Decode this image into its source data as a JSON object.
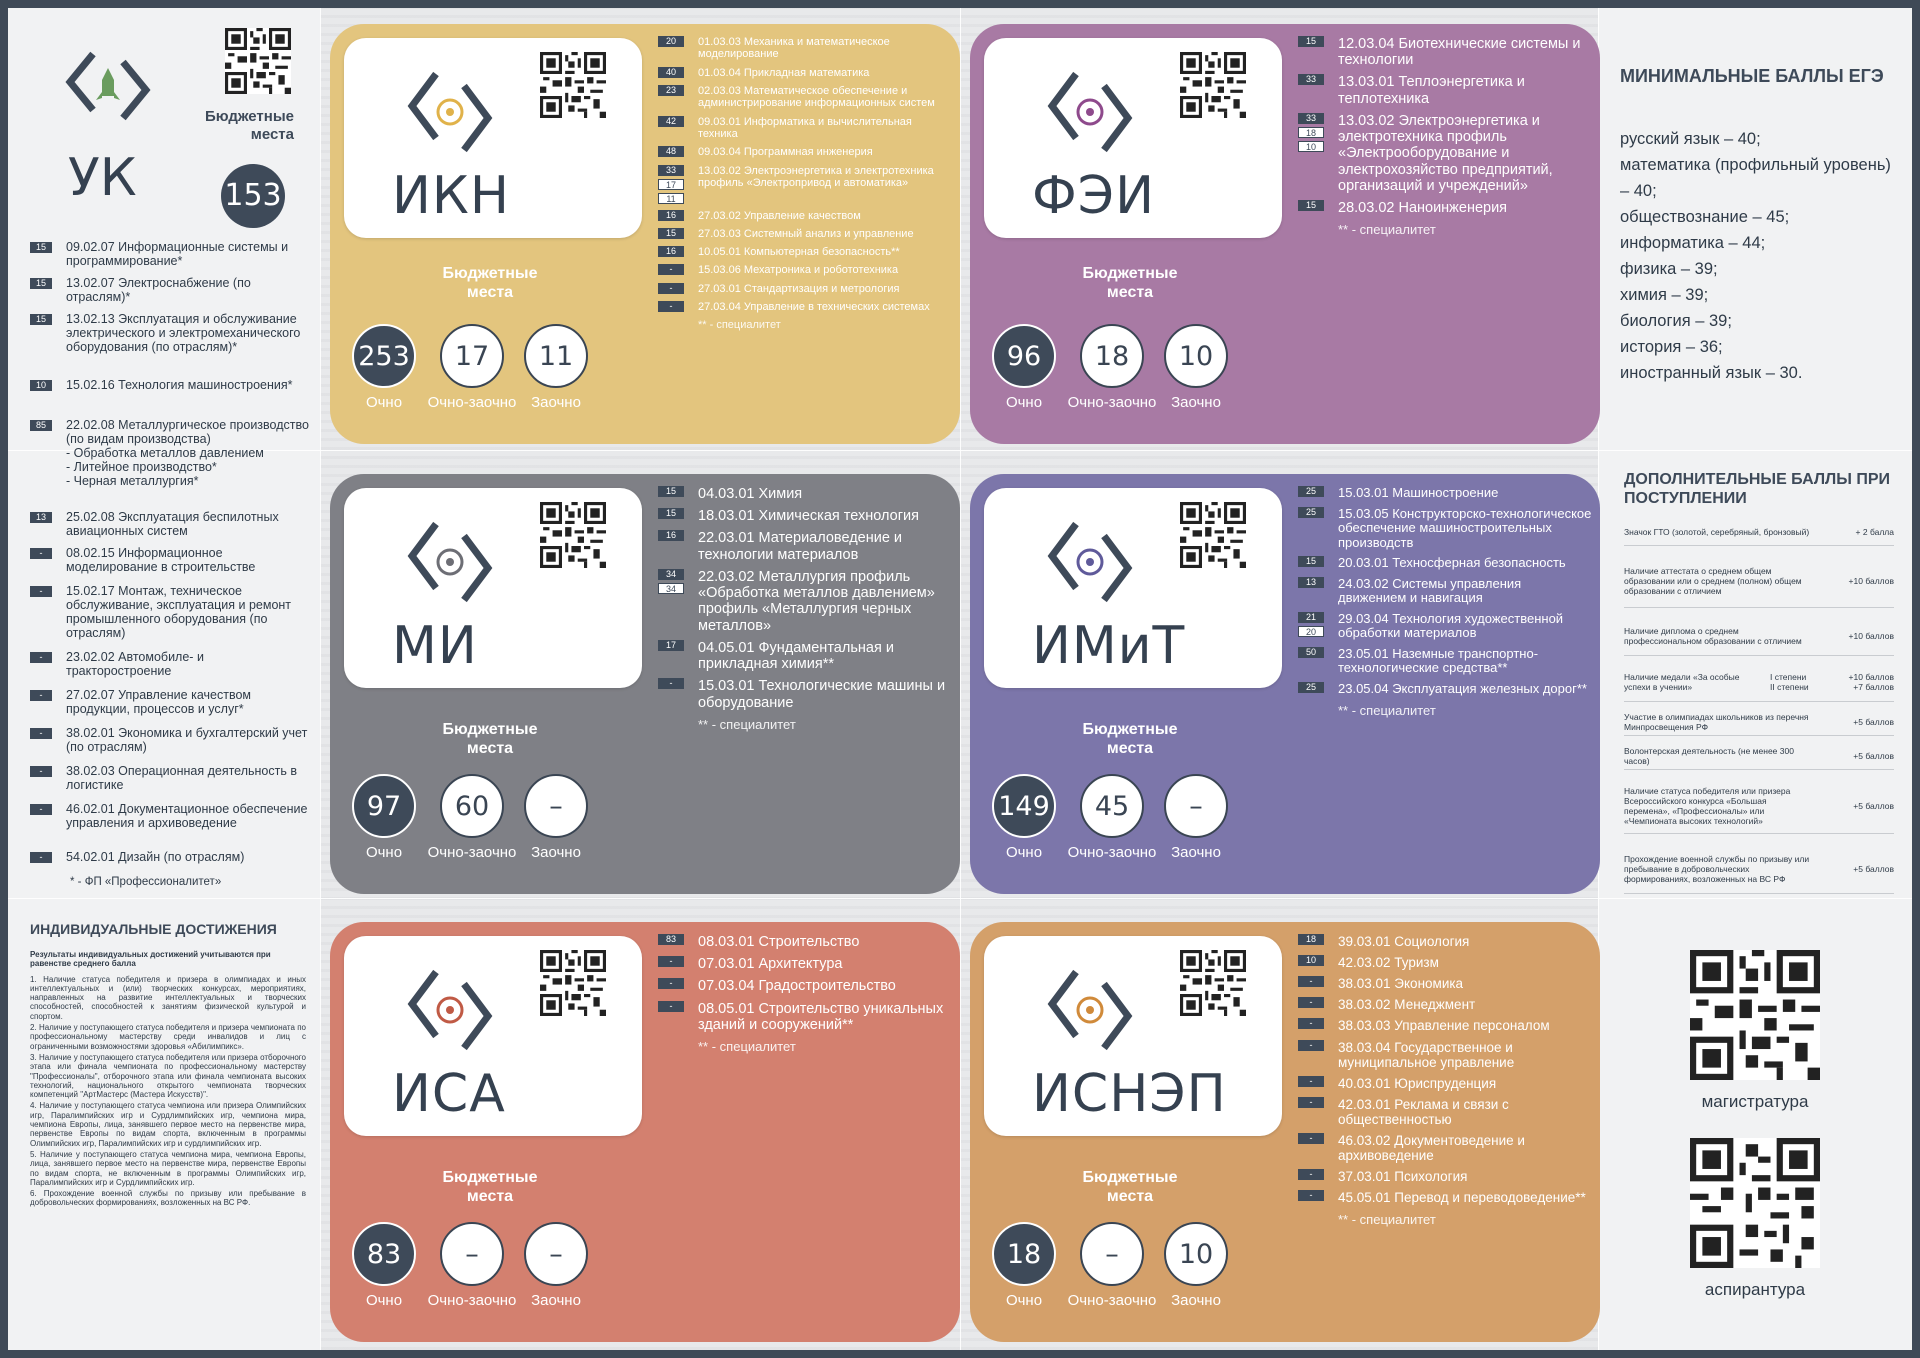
{
  "uk": {
    "abbr": "УК",
    "budget_label": "Бюджетные места",
    "budget": "153",
    "footnote": "* - ФП «Профессионалитет»",
    "programs": [
      {
        "n": "15",
        "t": "09.02.07  Информационные системы и программирование*"
      },
      {
        "n": "15",
        "t": "13.02.07  Электроснабжение (по отраслям)*"
      },
      {
        "n": "15",
        "t": "13.02.13  Эксплуатация и обслуживание электрического и электромеханического оборудования (по отраслям)*"
      },
      {
        "n": "10",
        "t": "15.02.16  Технология машиностроения*"
      },
      {
        "n": "85",
        "t": "22.02.08  Металлургическое производство (по видам производства)\n- Обработка металлов давлением\n- Литейное производство*\n- Черная металлургия*"
      },
      {
        "n": "13",
        "t": "25.02.08  Эксплуатация беспилотных авиационных систем"
      },
      {
        "n": "-",
        "t": "08.02.15  Информационное моделирование в строительстве"
      },
      {
        "n": "-",
        "t": "15.02.17  Монтаж, техническое обслуживание, эксплуатация и ремонт промышленного оборудования (по отраслям)"
      },
      {
        "n": "-",
        "t": "23.02.02  Автомобиле- и тракторостроение"
      },
      {
        "n": "-",
        "t": "27.02.07  Управление качеством продукции, процессов и услуг*"
      },
      {
        "n": "-",
        "t": "38.02.01  Экономика и бухгалтерский учет (по отраслям)"
      },
      {
        "n": "-",
        "t": "38.02.03  Операционная деятельность в логистике"
      },
      {
        "n": "-",
        "t": "46.02.01  Документационное обеспечение управления и архивоведение"
      },
      {
        "n": "-",
        "t": "54.02.01  Дизайн (по отраслям)"
      }
    ]
  },
  "achievements": {
    "title": "ИНДИВИДУАЛЬНЫЕ ДОСТИЖЕНИЯ",
    "intro": "Результаты индивидуальных достижений учитываются при равенстве среднего балла",
    "items": [
      "1. Наличие статуса победителя и призера в олимпиадах и иных интеллектуальных и (или) творческих конкурсах, мероприятиях, направленных на развитие интеллектуальных и творческих способностей, способностей к занятиям физической культурой и спортом.",
      "2. Наличие у поступающего статуса победителя и призера чемпионата по профессиональному мастерству среди инвалидов и лиц с ограниченными возможностями здоровья «Абилимпикс».",
      "3. Наличие у поступающего статуса победителя или призера отборочного этапа или финала чемпионата по профессиональному мастерству \"Профессионалы\", отборочного этапа или финала чемпионата высоких технологий, национального открытого чемпионата творческих компетенций \"АртМастерс (Мастера Искусств)\".",
      "4. Наличие у поступающего статуса чемпиона или призера Олимпийских игр, Паралимпийских игр и Сурдлимпийских игр, чемпиона мира, чемпиона Европы, лица, занявшего первое место на первенстве мира, первенстве Европы по видам спорта, включенным в программы Олимпийских игр, Паралимпийских игр и сурдлимпийских игр.",
      "5. Наличие у поступающего статуса чемпиона мира, чемпиона Европы, лица, занявшего первое место на первенстве мира, первенстве Европы по видам спорта, не включенным в программы Олимпийских игр, Паралимпийских игр и Сурдлимпийских игр.",
      "6. Прохождение военной службы по призыву или пребывание в добровольческих формированиях, возложенных на ВС РФ."
    ]
  },
  "labels": {
    "budget": "Бюджетные места",
    "och": "Очно",
    "ochzaoch": "Очно-заочно",
    "zaoch": "Заочно",
    "spec": "** - специалитет"
  },
  "cards": [
    {
      "abbr": "ИКН",
      "color": "#e3c57e",
      "vals": [
        "253",
        "17",
        "11"
      ],
      "programs": [
        {
          "b": [
            "20"
          ],
          "t": "01.03.03  Механика и математическое моделирование"
        },
        {
          "b": [
            "40"
          ],
          "t": "01.03.04  Прикладная математика"
        },
        {
          "b": [
            "23"
          ],
          "t": "02.03.03  Математическое обеспечение и администрирование информационных систем"
        },
        {
          "b": [
            "42"
          ],
          "t": "09.03.01  Информатика и вычислительная техника"
        },
        {
          "b": [
            "48"
          ],
          "t": "09.03.04  Программная инженерия"
        },
        {
          "b": [
            "33",
            "17",
            "11"
          ],
          "t": "13.03.02  Электроэнергетика и электротехника профиль «Электропривод и автоматика»"
        },
        {
          "b": [
            "16"
          ],
          "t": "27.03.02  Управление качеством"
        },
        {
          "b": [
            "15"
          ],
          "t": "27.03.03  Системный анализ и управление"
        },
        {
          "b": [
            "16"
          ],
          "t": "10.05.01  Компьютерная безопасность**"
        },
        {
          "b": [
            "-"
          ],
          "t": "15.03.06  Мехатроника и робототехника"
        },
        {
          "b": [
            "-"
          ],
          "t": "27.03.01  Стандартизация и метрология"
        },
        {
          "b": [
            "-"
          ],
          "t": "27.03.04  Управление в технических системах"
        }
      ]
    },
    {
      "abbr": "ФЭИ",
      "color": "#a87aa4",
      "vals": [
        "96",
        "18",
        "10"
      ],
      "programs": [
        {
          "b": [
            "15"
          ],
          "t": "12.03.04  Биотехнические системы и технологии"
        },
        {
          "b": [
            "33"
          ],
          "t": "13.03.01  Теплоэнергетика и теплотехника"
        },
        {
          "b": [
            "33",
            "18",
            "10"
          ],
          "t": "13.03.02  Электроэнергетика и электротехника профиль «Электрооборудование и электрохозяйство предприятий, организаций и учреждений»"
        },
        {
          "b": [
            "15"
          ],
          "t": "28.03.02  Наноинженерия"
        }
      ]
    },
    {
      "abbr": "МИ",
      "color": "#7f8086",
      "vals": [
        "97",
        "60",
        "–"
      ],
      "programs": [
        {
          "b": [
            "15"
          ],
          "t": "04.03.01  Химия"
        },
        {
          "b": [
            "15"
          ],
          "t": "18.03.01  Химическая технология"
        },
        {
          "b": [
            "16"
          ],
          "t": "22.03.01  Материаловедение и технологии материалов"
        },
        {
          "b": [
            "34",
            "34"
          ],
          "t": "22.03.02  Металлургия профиль «Обработка металлов давлением» профиль «Металлургия черных металлов»"
        },
        {
          "b": [
            "17"
          ],
          "t": "04.05.01  Фундаментальная и прикладная химия**"
        },
        {
          "b": [
            "-"
          ],
          "t": "15.03.01  Технологические машины и оборудование"
        }
      ]
    },
    {
      "abbr": "ИМиТ",
      "color": "#7c76aa",
      "vals": [
        "149",
        "45",
        "–"
      ],
      "programs": [
        {
          "b": [
            "25"
          ],
          "t": "15.03.01  Машиностроение"
        },
        {
          "b": [
            "25"
          ],
          "t": "15.03.05  Конструкторско-технологическое обеспечение машиностроительных производств"
        },
        {
          "b": [
            "15"
          ],
          "t": "20.03.01  Техносферная безопасность"
        },
        {
          "b": [
            "13"
          ],
          "t": "24.03.02  Системы управления движением и навигация"
        },
        {
          "b": [
            "21",
            "20"
          ],
          "t": "29.03.04  Технология художественной обработки материалов"
        },
        {
          "b": [
            "50"
          ],
          "t": "23.05.01  Наземные транспортно-технологические средства**"
        },
        {
          "b": [
            "25"
          ],
          "t": "23.05.04  Эксплуатация железных дорог**"
        }
      ]
    },
    {
      "abbr": "ИСА",
      "color": "#d3806f",
      "vals": [
        "83",
        "–",
        "–"
      ],
      "programs": [
        {
          "b": [
            "83"
          ],
          "t": "08.03.01  Строительство"
        },
        {
          "b": [
            "-"
          ],
          "t": "07.03.01  Архитектура"
        },
        {
          "b": [
            "-"
          ],
          "t": "07.03.04  Градостроительство"
        },
        {
          "b": [
            "-"
          ],
          "t": "08.05.01  Строительство уникальных зданий и сооружений**"
        }
      ]
    },
    {
      "abbr": "ИСНЭП",
      "color": "#d4a06a",
      "vals": [
        "18",
        "–",
        "10"
      ],
      "programs": [
        {
          "b": [
            "18"
          ],
          "t": "39.03.01  Социология"
        },
        {
          "b": [
            "10"
          ],
          "t": "42.03.02  Туризм"
        },
        {
          "b": [
            "-"
          ],
          "t": "38.03.01  Экономика"
        },
        {
          "b": [
            "-"
          ],
          "t": "38.03.02  Менеджмент"
        },
        {
          "b": [
            "-"
          ],
          "t": "38.03.03  Управление персоналом"
        },
        {
          "b": [
            "-"
          ],
          "t": "38.03.04  Государственное и муниципальное управление"
        },
        {
          "b": [
            "-"
          ],
          "t": "40.03.01  Юриспруденция"
        },
        {
          "b": [
            "-"
          ],
          "t": "42.03.01  Реклама и связи с общественностью"
        },
        {
          "b": [
            "-"
          ],
          "t": "46.03.02  Документоведение и архивоведение"
        },
        {
          "b": [
            "-"
          ],
          "t": "37.03.01  Психология"
        },
        {
          "b": [
            "-"
          ],
          "t": "45.05.01  Перевод и переводоведение**"
        }
      ]
    }
  ],
  "egse": {
    "title": "МИНИМАЛЬНЫЕ БАЛЛЫ ЕГЭ",
    "items": [
      "русский язык – 40;",
      "математика (профильный уровень) – 40;",
      "обществознание – 45;",
      "информатика – 44;",
      "физика – 39;",
      "химия – 39;",
      "биология – 39;",
      "история – 36;",
      "иностранный язык – 30."
    ]
  },
  "bonuses": {
    "title": "ДОПОЛНИТЕЛЬНЫЕ БАЛЛЫ ПРИ ПОСТУПЛЕНИИ",
    "items": [
      {
        "d": "Значок ГТО (золотой, серебряный, бронзовый)",
        "v": "+ 2 балла"
      },
      {
        "d": "Наличие аттестата о среднем общем образовании или о среднем (полном) общем образовании с отличием",
        "v": "+10 баллов"
      },
      {
        "d": "Наличие диплома о среднем профессиональном образовании с отличием",
        "v": "+10 баллов"
      },
      {
        "d": "Наличие медали «За особые успехи в учении»",
        "sub": "I степени\nII степени",
        "v": "+10 баллов\n+7 баллов"
      },
      {
        "d": "Участие в олимпиадах школьников из перечня Минпросвещения РФ",
        "v": "+5 баллов"
      },
      {
        "d": "Волонтерская деятельность (не менее 300 часов)",
        "v": "+5 баллов"
      },
      {
        "d": "Наличие статуса победителя или призера Всероссийского конкурса «Большая перемена», «Профессионалы» или «Чемпионата высоких технологий»",
        "v": "+5 баллов"
      },
      {
        "d": "Прохождение военной службы по призыву или пребывание в добровольческих формированиях, возложенных на ВС РФ",
        "v": "+5 баллов"
      }
    ]
  },
  "qr_labels": {
    "mag": "магистратура",
    "asp": "аспирантура"
  }
}
